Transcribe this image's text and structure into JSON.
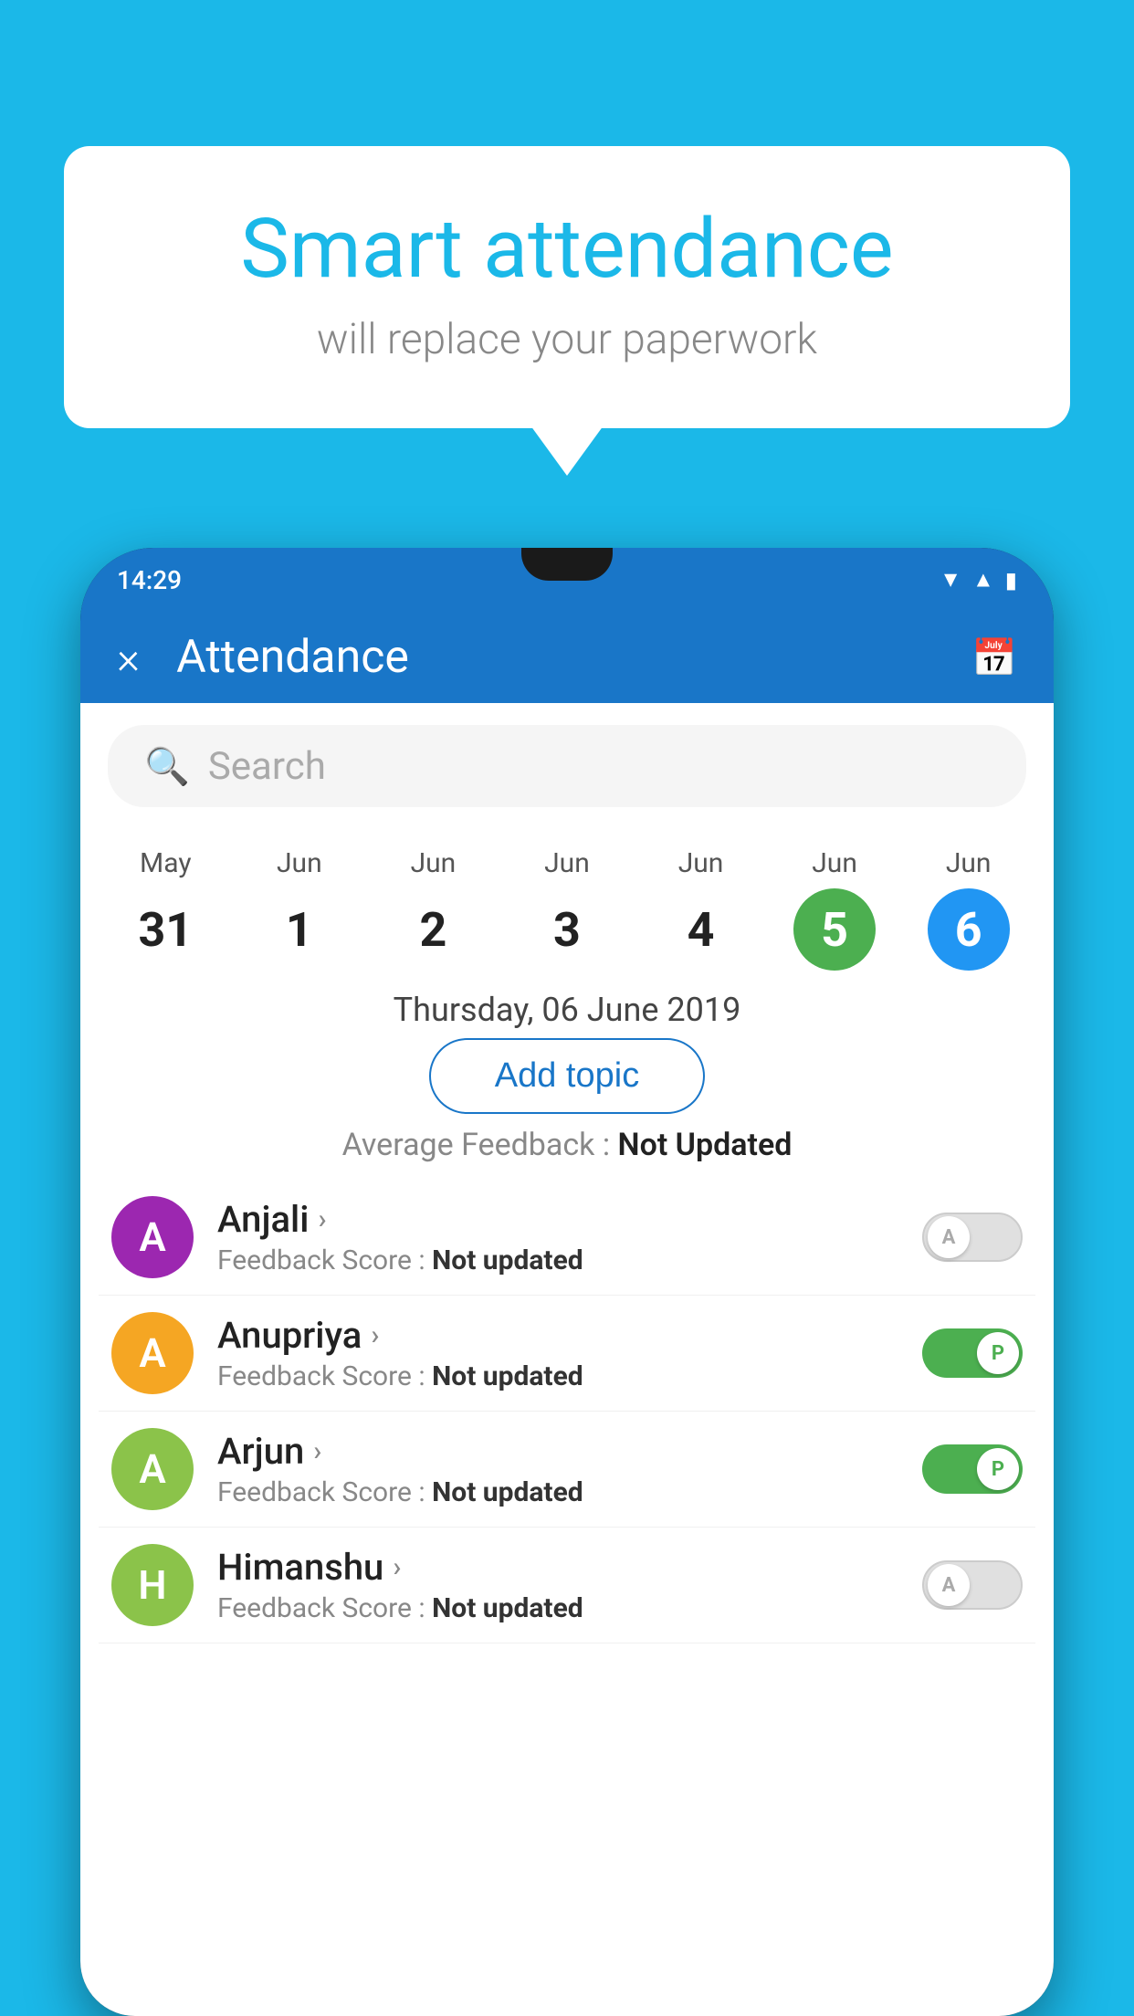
{
  "background_color": "#1bb8e8",
  "bubble": {
    "title": "Smart attendance",
    "subtitle": "will replace your paperwork"
  },
  "status_bar": {
    "time": "14:29"
  },
  "header": {
    "title": "Attendance",
    "close_label": "×",
    "calendar_icon": "📅"
  },
  "search": {
    "placeholder": "Search"
  },
  "dates": [
    {
      "month": "May",
      "day": "31",
      "state": "normal"
    },
    {
      "month": "Jun",
      "day": "1",
      "state": "normal"
    },
    {
      "month": "Jun",
      "day": "2",
      "state": "normal"
    },
    {
      "month": "Jun",
      "day": "3",
      "state": "normal"
    },
    {
      "month": "Jun",
      "day": "4",
      "state": "normal"
    },
    {
      "month": "Jun",
      "day": "5",
      "state": "today"
    },
    {
      "month": "Jun",
      "day": "6",
      "state": "selected"
    }
  ],
  "selected_date_label": "Thursday, 06 June 2019",
  "add_topic_label": "Add topic",
  "avg_feedback_label": "Average Feedback : ",
  "avg_feedback_value": "Not Updated",
  "students": [
    {
      "name": "Anjali",
      "initial": "A",
      "avatar_color": "#9c27b0",
      "feedback_label": "Feedback Score : ",
      "feedback_value": "Not updated",
      "toggle": "off",
      "toggle_letter": "A"
    },
    {
      "name": "Anupriya",
      "initial": "A",
      "avatar_color": "#f5a623",
      "feedback_label": "Feedback Score : ",
      "feedback_value": "Not updated",
      "toggle": "on",
      "toggle_letter": "P"
    },
    {
      "name": "Arjun",
      "initial": "A",
      "avatar_color": "#8bc34a",
      "feedback_label": "Feedback Score : ",
      "feedback_value": "Not updated",
      "toggle": "on",
      "toggle_letter": "P"
    },
    {
      "name": "Himanshu",
      "initial": "H",
      "avatar_color": "#8bc34a",
      "feedback_label": "Feedback Score : ",
      "feedback_value": "Not updated",
      "toggle": "off",
      "toggle_letter": "A"
    }
  ]
}
